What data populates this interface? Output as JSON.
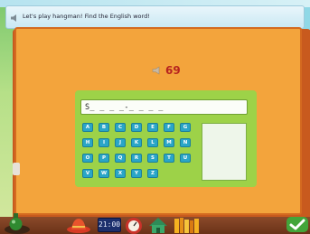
{
  "banner": {
    "instruction": "Let's play hangman! Find the English word!"
  },
  "score": {
    "value": "69"
  },
  "word": {
    "display": "S_ _ _ _-_ _ _ _"
  },
  "keyboard": {
    "rows": [
      [
        "A",
        "B",
        "C",
        "D",
        "E",
        "F",
        "G"
      ],
      [
        "H",
        "I",
        "J",
        "K",
        "L",
        "M",
        "N"
      ],
      [
        "O",
        "P",
        "Q",
        "R",
        "S",
        "T",
        "U"
      ],
      [
        "V",
        "W",
        "X",
        "Y",
        "Z"
      ]
    ]
  },
  "toolbar": {
    "clock": "21:00",
    "icons": [
      "potion-icon",
      "hat-icon",
      "clock-display",
      "gauge-icon",
      "house-icon",
      "books-icon",
      "checkmark-icon"
    ]
  },
  "colors": {
    "board": "#f3a43c",
    "panel": "#9dd248",
    "key": "#2aa6c7",
    "score": "#b7241f"
  }
}
